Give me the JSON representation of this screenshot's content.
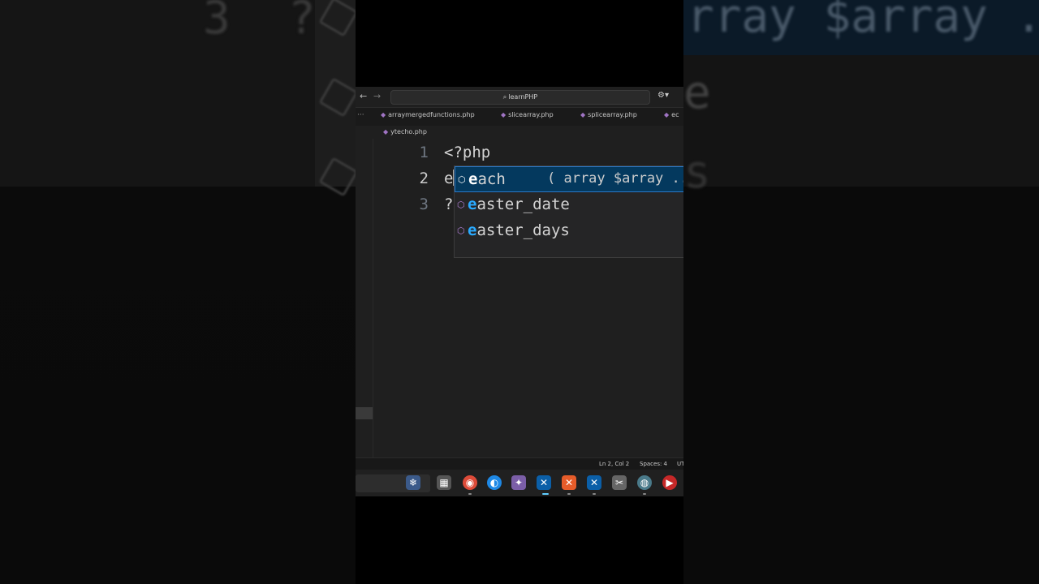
{
  "window": {
    "search_text": "learnPHP"
  },
  "tabs": [
    {
      "label": "arraymergedfunctions.php"
    },
    {
      "label": "slicearray.php"
    },
    {
      "label": "splicearray.php"
    },
    {
      "label": "ec"
    }
  ],
  "breadcrumb": {
    "file": "ytecho.php"
  },
  "editor": {
    "lines": [
      {
        "number": "1",
        "text": "<?php"
      },
      {
        "number": "2",
        "text": "e"
      },
      {
        "number": "3",
        "text": "?"
      }
    ]
  },
  "suggestions": [
    {
      "match": "e",
      "rest": "ach",
      "signature": "( array $array ..."
    },
    {
      "match": "e",
      "rest": "aster_date",
      "signature": ""
    },
    {
      "match": "e",
      "rest": "aster_days",
      "signature": ""
    }
  ],
  "status": {
    "position": "Ln 2, Col 2",
    "spaces": "Spaces: 4",
    "encoding": "UT"
  },
  "background": {
    "left_text_1": "3",
    "left_text_2": "?",
    "right_text_1": "rray $array .",
    "right_text_2": "e",
    "right_text_3": "s"
  },
  "icons": {
    "back": "arrow-left-icon",
    "forward": "arrow-right-icon",
    "search": "search-icon",
    "copilot": "copilot-icon",
    "php": "php-file-icon",
    "method": "method-cube-icon"
  },
  "colors": {
    "accent": "#2aaaff",
    "selection": "#04395e",
    "php_tag": "#569cd6",
    "php_icon": "#a074c4"
  }
}
